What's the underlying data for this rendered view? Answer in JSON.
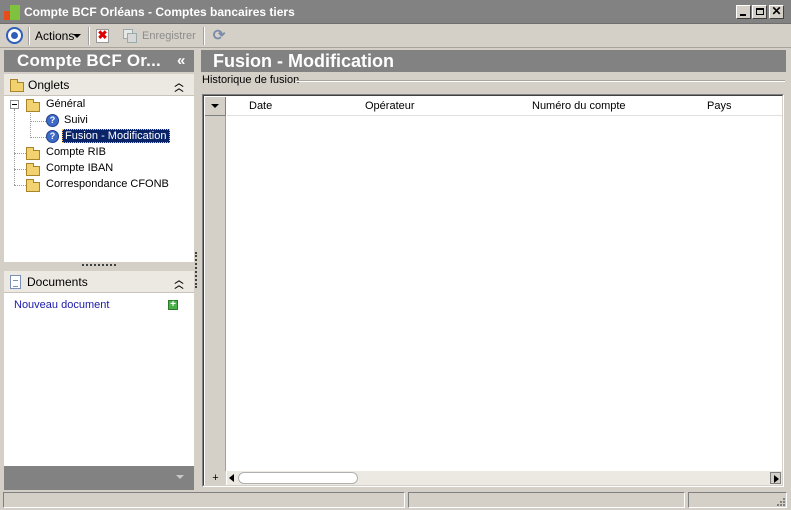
{
  "window": {
    "title": "Compte BCF Orléans -  Comptes bancaires tiers",
    "minimize_icon": "minimize-icon",
    "maximize_icon": "maximize-icon",
    "close_icon": "close-icon",
    "title_colors": {
      "bar": "#828282",
      "text": "#ffffff"
    }
  },
  "toolbar": {
    "actions_label": "Actions",
    "save_label": "Enregistrer",
    "delete_icon": "delete-icon",
    "refresh_icon": "refresh-icon"
  },
  "left_panel": {
    "header": "Compte BCF Or...",
    "collapse_glyph": "«",
    "onglets_label": "Onglets",
    "tree": [
      {
        "label": "Général",
        "expanded": true,
        "children": [
          {
            "label": "Suivi"
          },
          {
            "label": "Fusion - Modification",
            "selected": true
          }
        ]
      },
      {
        "label": "Compte RIB"
      },
      {
        "label": "Compte IBAN"
      },
      {
        "label": "Correspondance CFONB"
      }
    ],
    "documents_label": "Documents",
    "new_document_label": "Nouveau document",
    "new_document_icon": "plus-icon"
  },
  "main": {
    "title": "Fusion - Modification",
    "group_label": "Historique de fusion",
    "table": {
      "columns": [
        "Date",
        "Opérateur",
        "Numéro du compte",
        "Pays"
      ],
      "rows": []
    },
    "add_row_glyph": "+"
  },
  "colors": {
    "header_bg": "#828282",
    "selection_bg": "#0a246a",
    "link": "#1a1aa8"
  }
}
